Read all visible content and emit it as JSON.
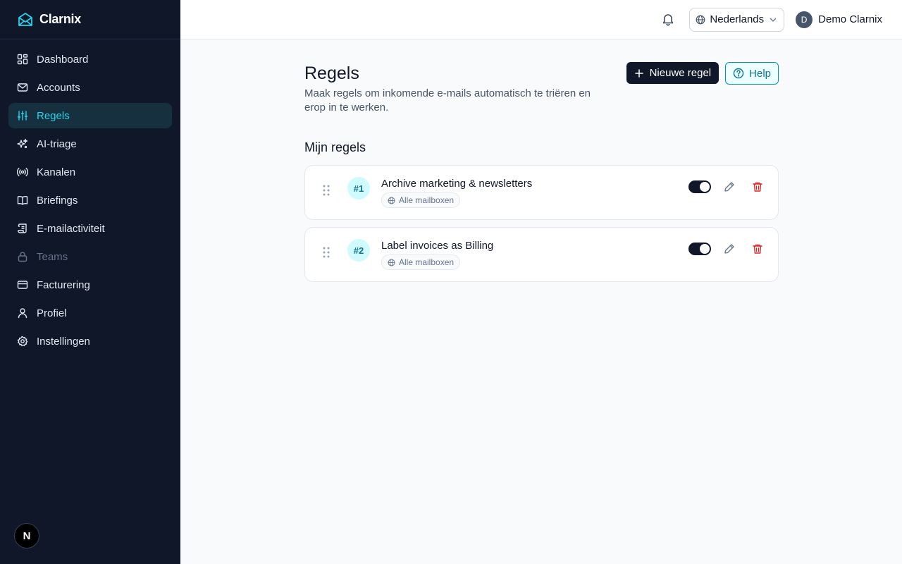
{
  "app": {
    "name": "Clarnix"
  },
  "sidebar": {
    "items": [
      {
        "label": "Dashboard",
        "icon": "dashboard-icon",
        "state": "normal"
      },
      {
        "label": "Accounts",
        "icon": "mail-icon",
        "state": "normal"
      },
      {
        "label": "Regels",
        "icon": "sliders-icon",
        "state": "active"
      },
      {
        "label": "AI-triage",
        "icon": "sparkles-icon",
        "state": "normal"
      },
      {
        "label": "Kanalen",
        "icon": "radio-icon",
        "state": "normal"
      },
      {
        "label": "Briefings",
        "icon": "book-icon",
        "state": "normal"
      },
      {
        "label": "E-mailactiviteit",
        "icon": "scroll-icon",
        "state": "normal"
      },
      {
        "label": "Teams",
        "icon": "lock-icon",
        "state": "disabled"
      },
      {
        "label": "Facturering",
        "icon": "credit-card-icon",
        "state": "normal"
      },
      {
        "label": "Profiel",
        "icon": "user-icon",
        "state": "normal"
      },
      {
        "label": "Instellingen",
        "icon": "gear-icon",
        "state": "normal"
      }
    ],
    "avatar_letter": "N"
  },
  "topbar": {
    "language": "Nederlands",
    "user_initial": "D",
    "user_name": "Demo Clarnix"
  },
  "page": {
    "title": "Regels",
    "description": "Maak regels om inkomende e-mails automatisch te triëren en erop in te werken.",
    "new_rule_label": "Nieuwe regel",
    "help_label": "Help",
    "section_title": "Mijn regels"
  },
  "rules": [
    {
      "number": "#1",
      "name": "Archive marketing & newsletters",
      "scope": "Alle mailboxen",
      "enabled": true
    },
    {
      "number": "#2",
      "name": "Label invoices as Billing",
      "scope": "Alle mailboxen",
      "enabled": true
    }
  ],
  "colors": {
    "sidebar_bg": "#0f1729",
    "accent": "#22d3ee",
    "danger": "#dc2626"
  }
}
